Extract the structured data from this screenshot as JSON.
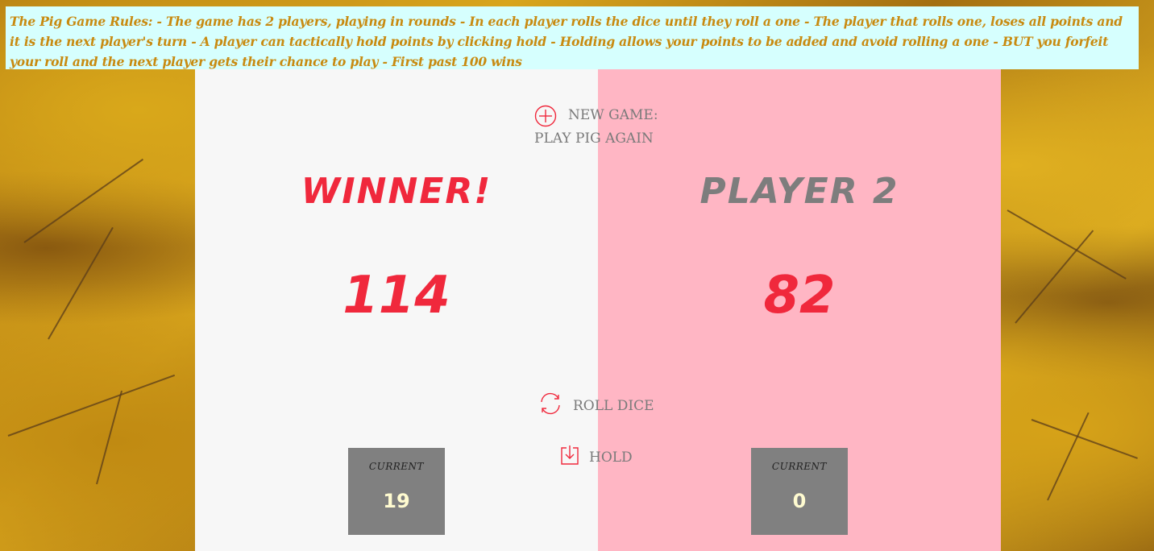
{
  "rules": {
    "text": "The Pig Game Rules: - The game has 2 players, playing in rounds - In each player rolls the dice until they roll a one - The player that rolls one, loses all points and it is the next player's turn - A player can tactically hold points by clicking hold - Holding allows your points to be added and avoid rolling a one - BUT you forfeit your roll and the next player gets their chance to play - First past 100 wins"
  },
  "controls": {
    "new_game_line1": "NEW GAME:",
    "new_game_line2": "PLAY PIG AGAIN",
    "roll_label": "ROLL DICE",
    "hold_label": "HOLD"
  },
  "players": [
    {
      "name": "WINNER!",
      "score": "114",
      "current_label": "CURRENT",
      "current_score": "19"
    },
    {
      "name": "PLAYER 2",
      "score": "82",
      "current_label": "CURRENT",
      "current_score": "0"
    }
  ],
  "colors": {
    "accent": "#f0283c",
    "panel_left": "#f7f7f7",
    "panel_right_active": "#ffb6c4",
    "rules_bg": "#d6fffe",
    "rules_text": "#c88a10",
    "current_box": "#808080"
  },
  "icons": {
    "new_game": "plus-circle-icon",
    "roll": "refresh-icon",
    "hold": "download-icon"
  }
}
